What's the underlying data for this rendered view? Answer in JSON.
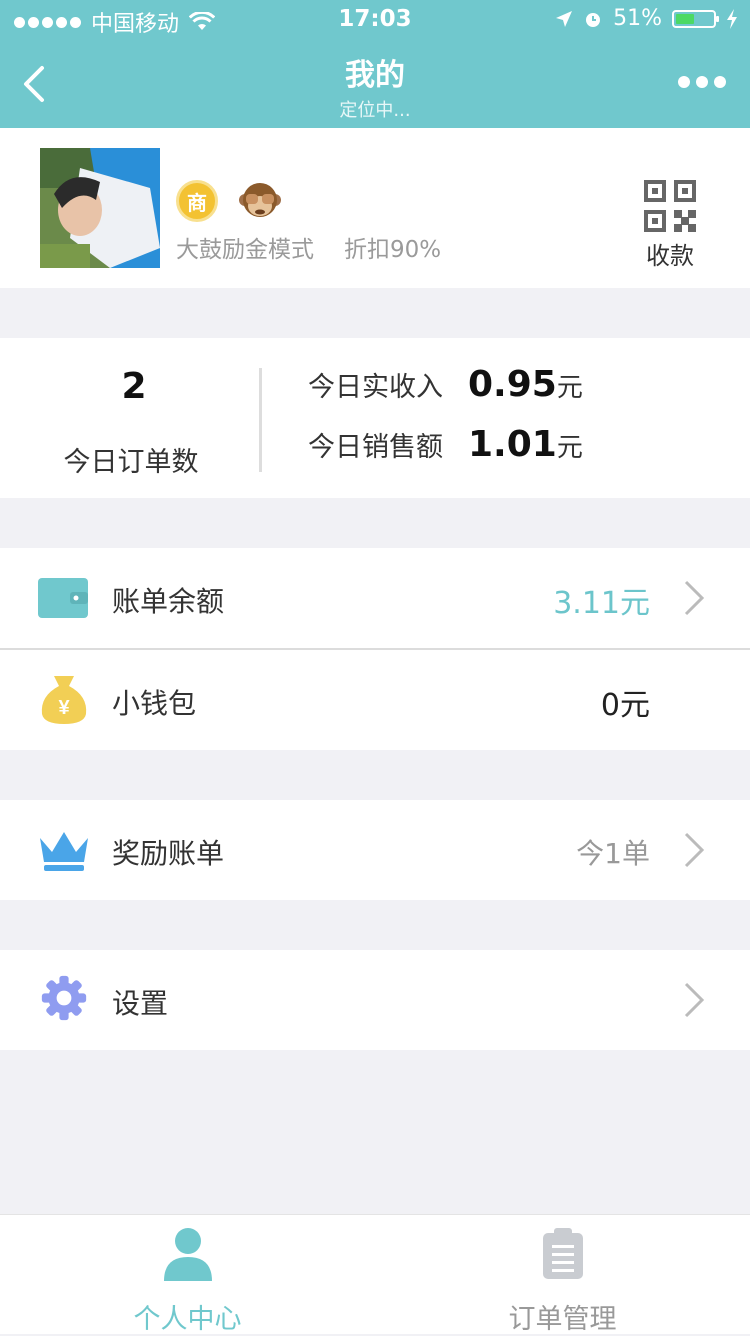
{
  "status_bar": {
    "carrier": "中国移动",
    "time": "17:03",
    "battery": "51%",
    "battery_level": 0.51
  },
  "nav": {
    "title": "我的",
    "subtitle": "定位中..."
  },
  "profile": {
    "badge": "商",
    "mode": "大鼓励金模式",
    "discount": "折扣90%",
    "qr_label": "收款"
  },
  "stats": {
    "order_count": "2",
    "order_count_label": "今日订单数",
    "income_label": "今日实收入",
    "income_value": "0.95",
    "income_unit": "元",
    "sales_label": "今日销售额",
    "sales_value": "1.01",
    "sales_unit": "元"
  },
  "menu": {
    "bill_balance": {
      "label": "账单余额",
      "value": "3.11元",
      "icon": "wallet-icon"
    },
    "small_wallet": {
      "label": "小钱包",
      "value": "0元",
      "icon": "money-bag-icon"
    },
    "reward_bill": {
      "label": "奖励账单",
      "value": "今1单",
      "icon": "crown-icon"
    },
    "settings": {
      "label": "设置",
      "icon": "gear-icon"
    }
  },
  "tabs": [
    {
      "label": "个人中心",
      "icon": "person-icon",
      "active": true
    },
    {
      "label": "订单管理",
      "icon": "clipboard-icon",
      "active": false
    }
  ],
  "colors": {
    "accent": "#70c8cd",
    "highlight_value": "#6cc5cb",
    "inactive": "#999999"
  }
}
